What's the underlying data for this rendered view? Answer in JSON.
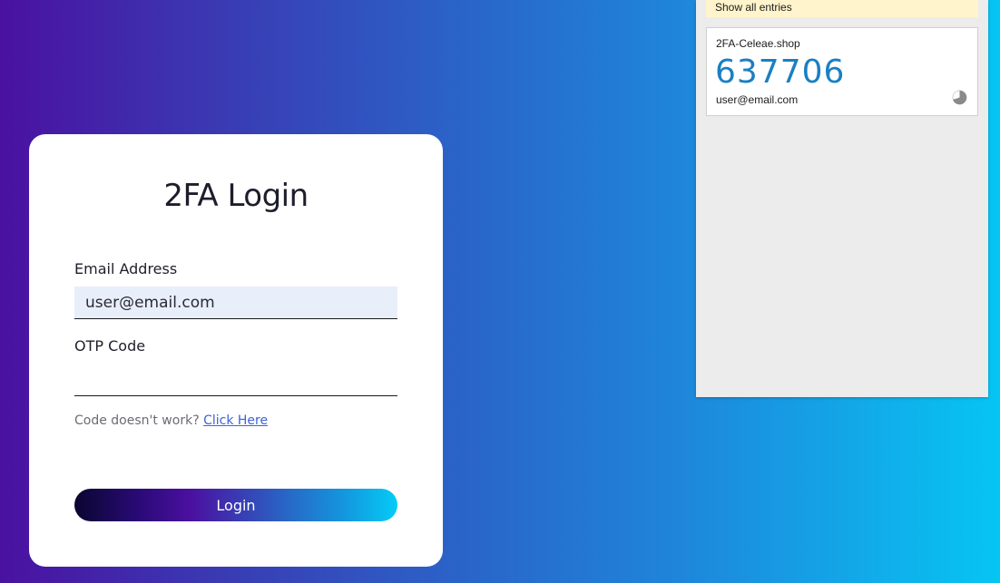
{
  "login": {
    "title": "2FA Login",
    "email_label": "Email Address",
    "email_value": "user@email.com",
    "otp_label": "OTP Code",
    "otp_value": "",
    "help_text": "Code doesn't work?",
    "help_link": "Click Here",
    "button_label": "Login"
  },
  "authenticator": {
    "show_all_label": "Show all entries",
    "entry": {
      "issuer": "2FA-Celeae.shop",
      "code": "637706",
      "account": "user@email.com",
      "timer_icon": "countdown-pie-icon",
      "timer_remaining_fraction": 0.7
    },
    "colors": {
      "code": "#1a7fc4",
      "show_all_background": "#fff4cc",
      "panel_background": "#ececec"
    }
  },
  "theme": {
    "background_gradient": [
      "#4a11a0",
      "#06c5f3"
    ],
    "button_gradient": [
      "#0a0630",
      "#4b10a0",
      "#05ccf5"
    ],
    "link_color": "#3a64d8"
  }
}
